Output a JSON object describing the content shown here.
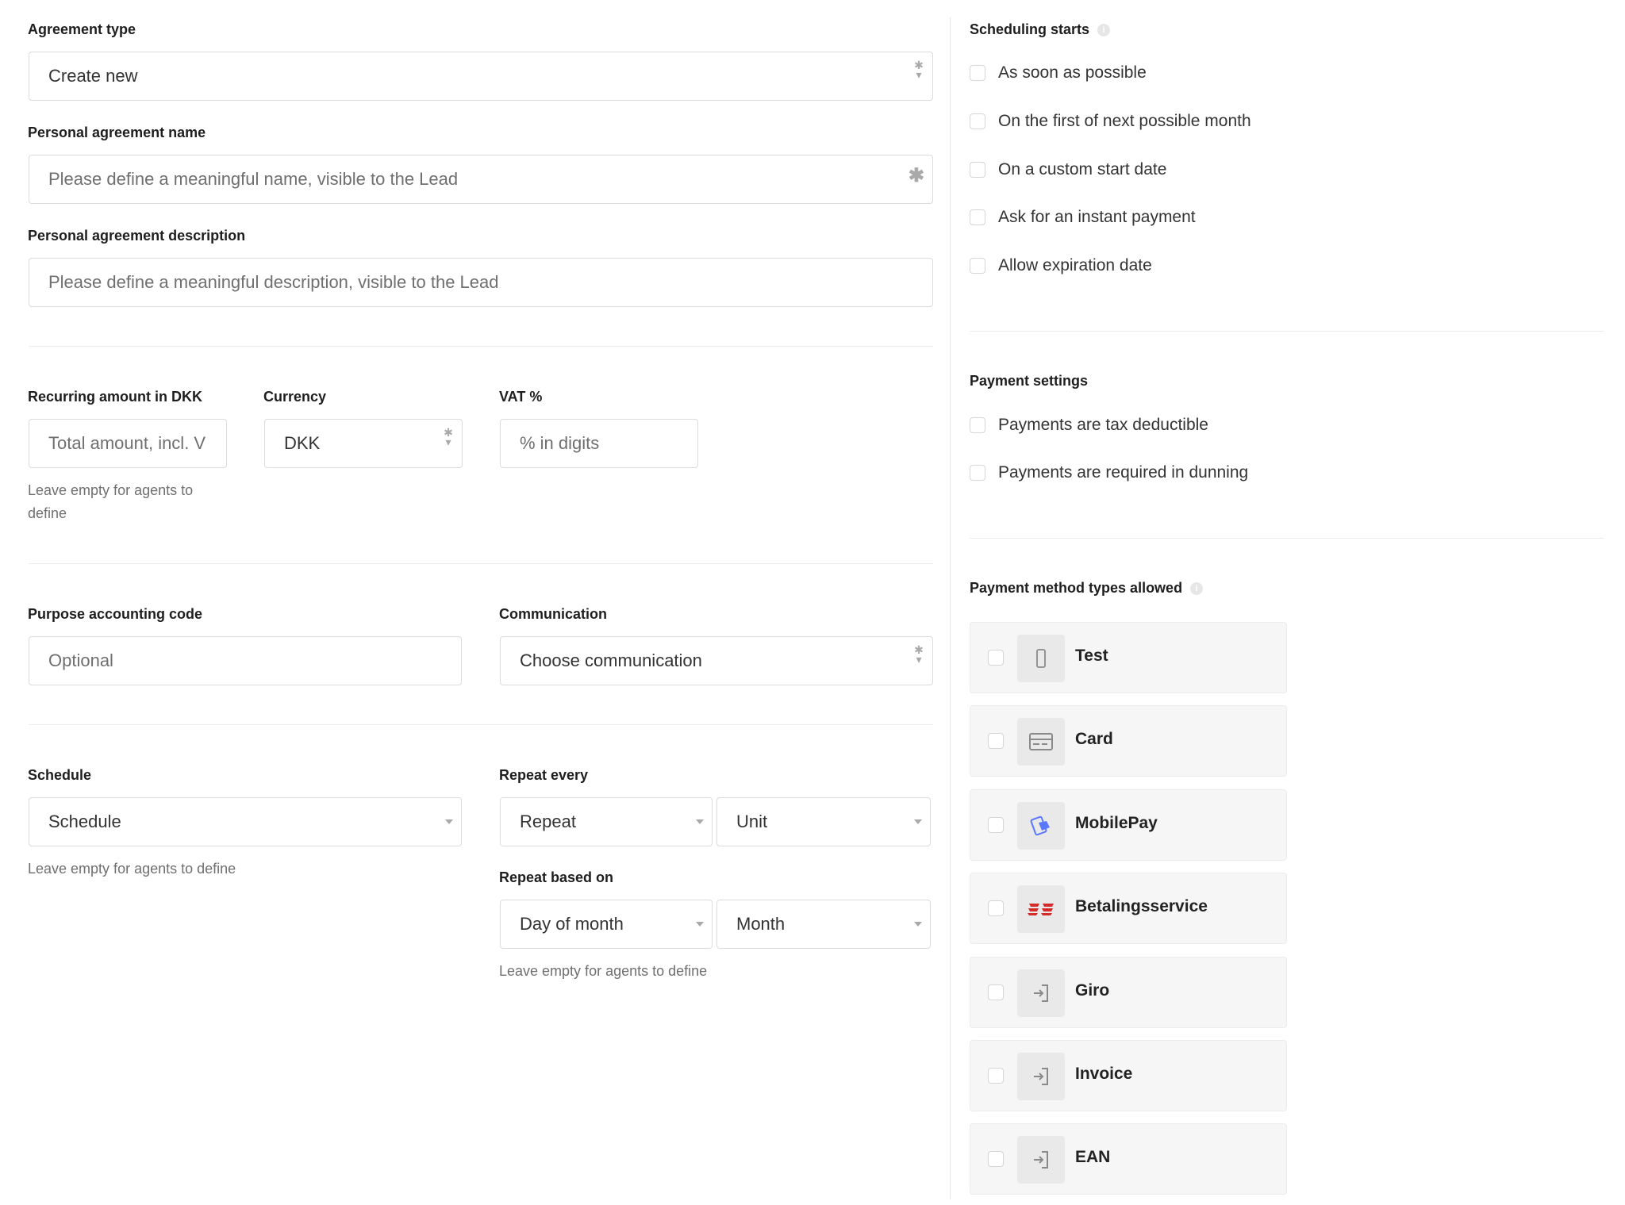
{
  "left": {
    "agreement_type": {
      "label": "Agreement type",
      "value": "Create new",
      "required_mark": "✱"
    },
    "name": {
      "label": "Personal agreement name",
      "placeholder": "Please define a meaningful name, visible to the Lead",
      "required_mark": "✱"
    },
    "description": {
      "label": "Personal agreement description",
      "placeholder": "Please define a meaningful description, visible to the Lead"
    },
    "recurring_amount": {
      "label": "Recurring amount in DKK",
      "placeholder": "Total amount, incl. V",
      "help": "Leave empty for agents to define"
    },
    "currency": {
      "label": "Currency",
      "value": "DKK",
      "required_mark": "✱"
    },
    "vat": {
      "label": "VAT %",
      "placeholder": "% in digits"
    },
    "purpose": {
      "label": "Purpose accounting code",
      "placeholder": "Optional"
    },
    "communication": {
      "label": "Communication",
      "value": "Choose communication",
      "required_mark": "✱"
    },
    "schedule": {
      "label": "Schedule",
      "value": "Schedule",
      "help": "Leave empty for agents to define"
    },
    "repeat_every": {
      "label": "Repeat every",
      "repeat_value": "Repeat",
      "unit_value": "Unit"
    },
    "repeat_based_on": {
      "label": "Repeat based on",
      "day_value": "Day of month",
      "month_value": "Month",
      "help": "Leave empty for agents to define"
    }
  },
  "right": {
    "scheduling": {
      "title": "Scheduling starts",
      "info_icon": "info-icon",
      "options": [
        "As soon as possible",
        "On the first of next possible month",
        "On a custom start date",
        "Ask for an instant payment",
        "Allow expiration date"
      ]
    },
    "payment_settings": {
      "title": "Payment settings",
      "options": [
        "Payments are tax deductible",
        "Payments are required in dunning"
      ]
    },
    "payment_methods": {
      "title": "Payment method types allowed",
      "info_icon": "info-icon",
      "items": [
        {
          "name": "Test",
          "icon": "phone-icon"
        },
        {
          "name": "Card",
          "icon": "credit-card-icon"
        },
        {
          "name": "MobilePay",
          "icon": "mobilepay-icon"
        },
        {
          "name": "Betalingsservice",
          "icon": "betalingsservice-icon"
        },
        {
          "name": "Giro",
          "icon": "login-arrow-icon"
        },
        {
          "name": "Invoice",
          "icon": "login-arrow-icon"
        },
        {
          "name": "EAN",
          "icon": "login-arrow-icon"
        }
      ]
    }
  },
  "colors": {
    "border": "#dcdcdc",
    "card_bg": "#f6f6f6",
    "mobilepay_blue": "#5a78ff",
    "betalingsservice_red": "#d42a2a"
  }
}
